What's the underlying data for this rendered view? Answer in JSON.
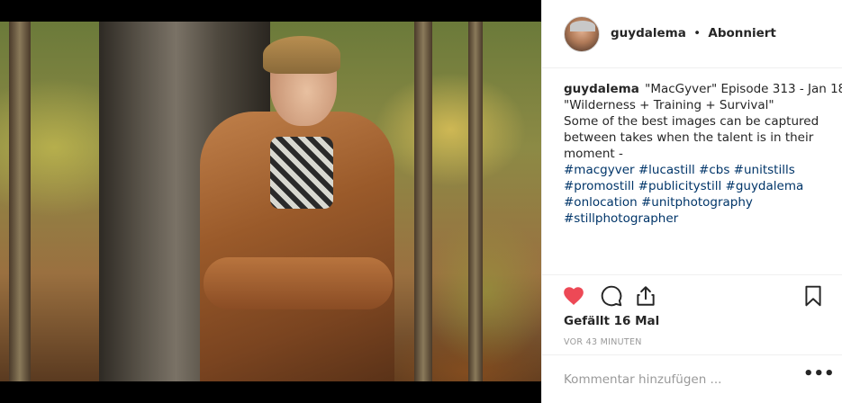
{
  "post": {
    "username": "guydalema",
    "separator": "•",
    "follow_status": "Abonniert",
    "caption_lines": [
      "\"MacGyver\" Episode 313 - Jan 18",
      "\"Wilderness + Training + Survival\"",
      "Some of the best images can be captured",
      "between takes when the talent is in their",
      "moment -"
    ],
    "hashtag_lines": [
      "#macgyver #lucastill #cbs #unitstills",
      "#promostill #publicitystill #guydalema",
      "#onlocation #unitphotography",
      "#stillphotographer"
    ],
    "likes_text": "Gefällt 16 Mal",
    "time_text": "VOR 43 MINUTEN",
    "comment_placeholder": "Kommentar hinzufügen ...",
    "more_label": "•••"
  },
  "icons": {
    "like": "heart-icon",
    "comment": "comment-icon",
    "share": "share-icon",
    "save": "bookmark-icon",
    "more": "more-options-icon"
  },
  "colors": {
    "like_red": "#ed4956",
    "hashtag_blue": "#003569",
    "text": "#262626",
    "muted": "#999999",
    "divider": "#efefef"
  }
}
